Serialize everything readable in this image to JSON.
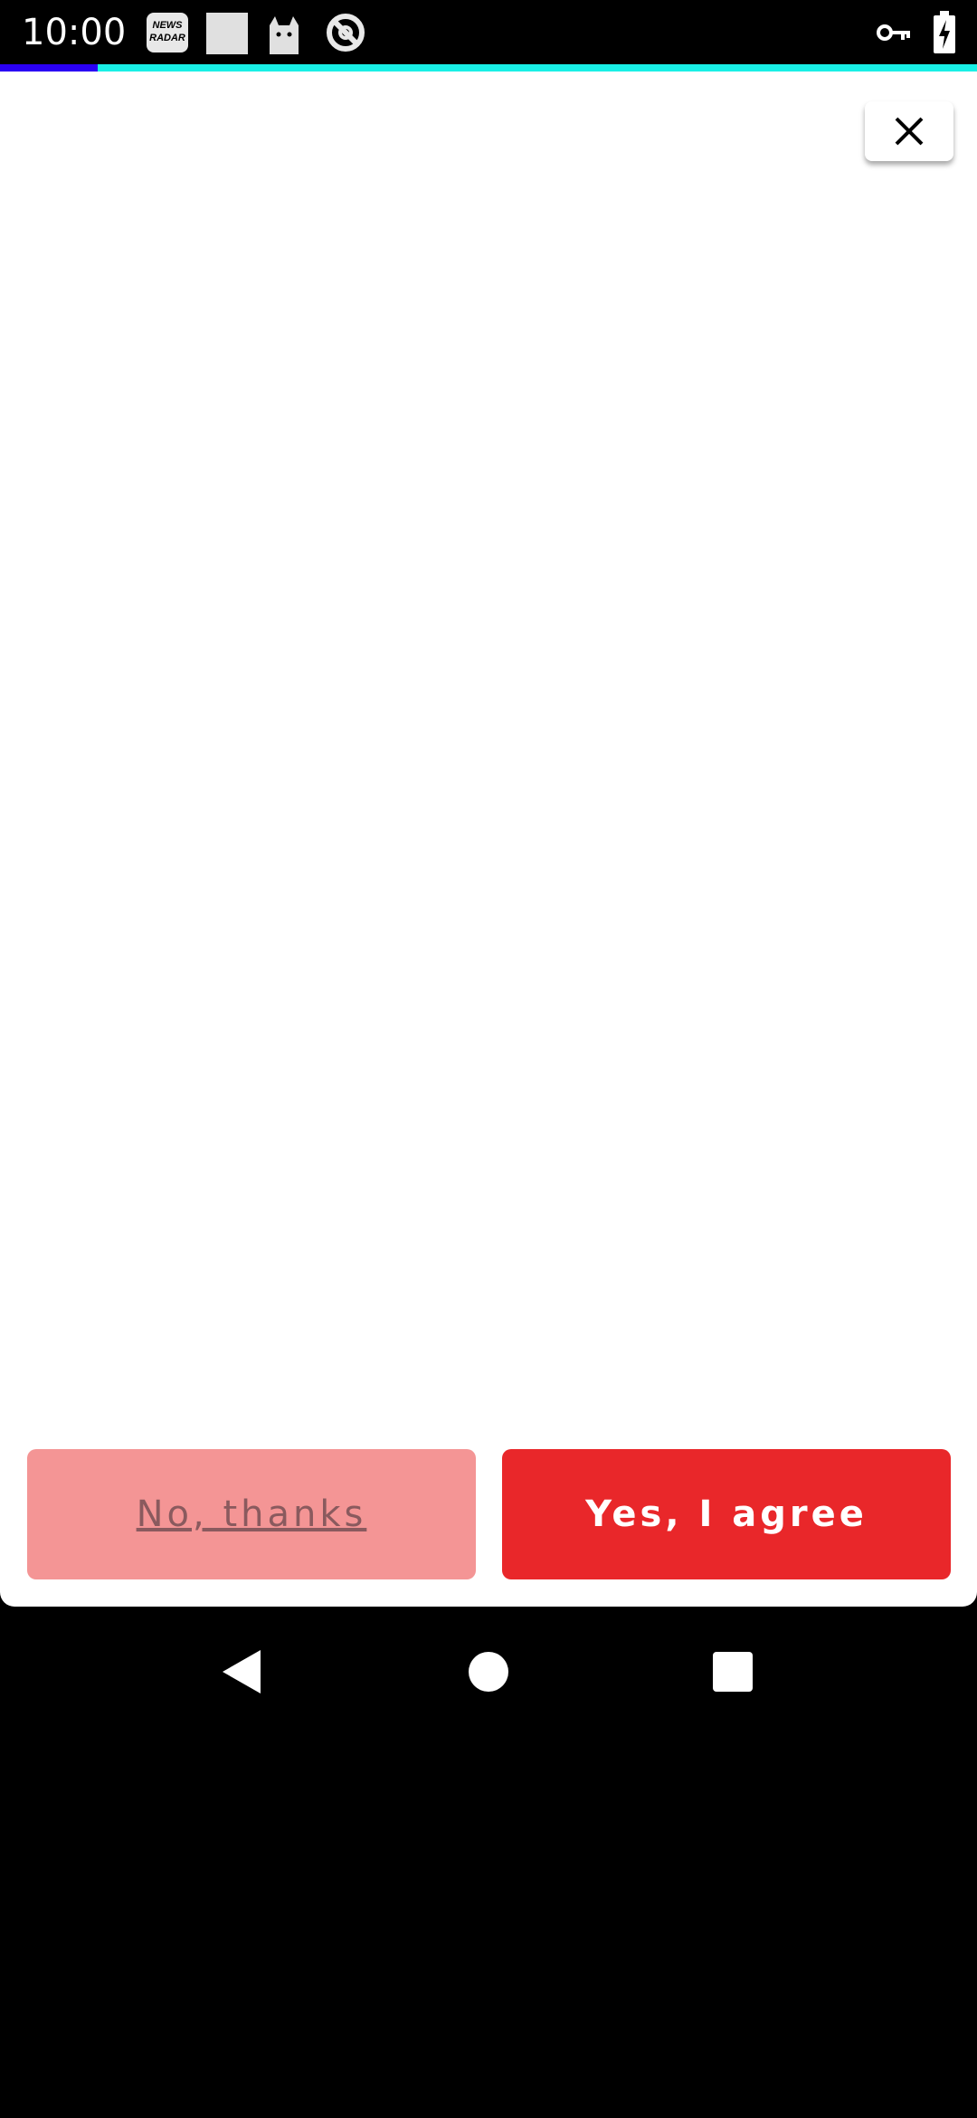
{
  "status_bar": {
    "time": "10:00",
    "news_icon_text": "NEWS RADAR",
    "left_icons": [
      "news-radar-icon",
      "blank-square-icon",
      "cat-icon",
      "blocked-icon"
    ],
    "right_icons": [
      "vpn-key-icon",
      "battery-charging-icon"
    ]
  },
  "progress": {
    "value_percent": 10,
    "fill_color": "#2a00f5",
    "track_color": "#19f0e6"
  },
  "dialog": {
    "close_icon": "close-icon",
    "decline_label": "No, thanks",
    "accept_label": "Yes, I agree",
    "decline_color": "#f49595",
    "accept_color": "#e9272a"
  },
  "nav_bar": {
    "icons": [
      "back-icon",
      "home-icon",
      "recents-icon"
    ]
  }
}
